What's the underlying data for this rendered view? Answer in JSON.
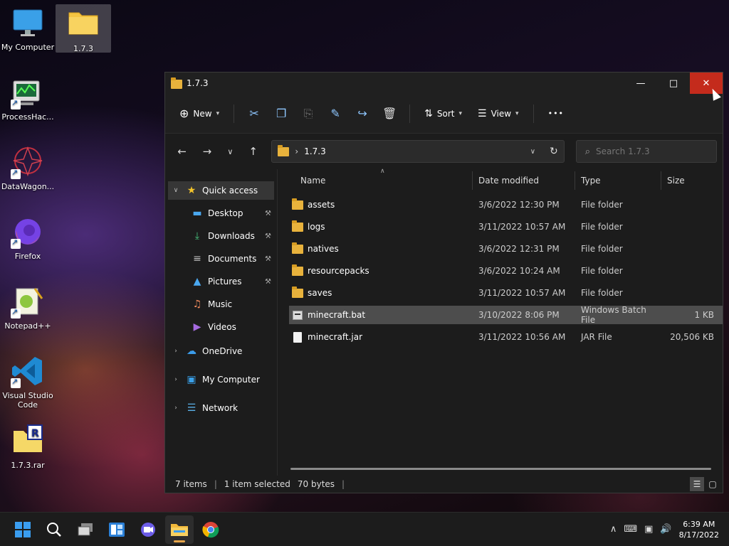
{
  "desktop": {
    "icons": [
      {
        "label": "My Computer"
      },
      {
        "label": "1.7.3"
      },
      {
        "label": "ProcessHac..."
      },
      {
        "label": "DataWagon..."
      },
      {
        "label": "Firefox"
      },
      {
        "label": "Notepad++"
      },
      {
        "label": "Visual Studio Code"
      },
      {
        "label": "1.7.3.rar"
      }
    ]
  },
  "window": {
    "title": "1.7.3",
    "toolbar": {
      "new_label": "New",
      "sort_label": "Sort",
      "view_label": "View",
      "more_label": "•••"
    },
    "address": {
      "crumb": "1.7.3",
      "search_placeholder": "Search 1.7.3"
    },
    "sidebar": {
      "quick_access": "Quick access",
      "items": [
        {
          "label": "Desktop"
        },
        {
          "label": "Downloads"
        },
        {
          "label": "Documents"
        },
        {
          "label": "Pictures"
        },
        {
          "label": "Music"
        },
        {
          "label": "Videos"
        }
      ],
      "onedrive": "OneDrive",
      "mycomputer": "My Computer",
      "network": "Network"
    },
    "columns": {
      "name": "Name",
      "date": "Date modified",
      "type": "Type",
      "size": "Size"
    },
    "files": [
      {
        "name": "assets",
        "date": "3/6/2022 12:30 PM",
        "type": "File folder",
        "size": ""
      },
      {
        "name": "logs",
        "date": "3/11/2022 10:57 AM",
        "type": "File folder",
        "size": ""
      },
      {
        "name": "natives",
        "date": "3/6/2022 12:31 PM",
        "type": "File folder",
        "size": ""
      },
      {
        "name": "resourcepacks",
        "date": "3/6/2022 10:24 AM",
        "type": "File folder",
        "size": ""
      },
      {
        "name": "saves",
        "date": "3/11/2022 10:57 AM",
        "type": "File folder",
        "size": ""
      },
      {
        "name": "minecraft.bat",
        "date": "3/10/2022 8:06 PM",
        "type": "Windows Batch File",
        "size": "1 KB"
      },
      {
        "name": "minecraft.jar",
        "date": "3/11/2022 10:56 AM",
        "type": "JAR File",
        "size": "20,506 KB"
      }
    ],
    "status": {
      "items": "7 items",
      "selected": "1 item selected",
      "bytes": "70 bytes"
    }
  },
  "taskbar": {
    "time": "6:39 AM",
    "date": "8/17/2022"
  },
  "colors": {
    "close_red": "#c42b1c",
    "folder_yellow": "#e8b23c",
    "accent_blue": "#8fc7ff"
  }
}
